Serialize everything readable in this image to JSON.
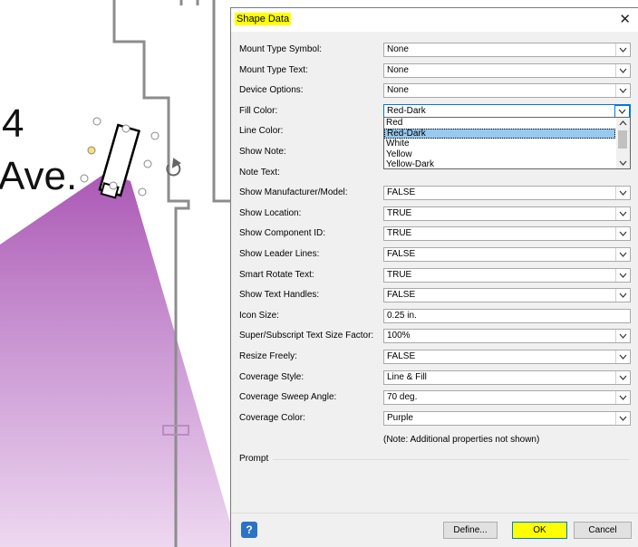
{
  "canvas": {
    "text_line1": "4",
    "text_line2": "Ave."
  },
  "dialog": {
    "title": "Shape Data",
    "close_glyph": "✕",
    "rows": [
      {
        "label": "Mount Type Symbol:",
        "value": "None",
        "kind": "dropdown"
      },
      {
        "label": "Mount Type Text:",
        "value": "None",
        "kind": "dropdown"
      },
      {
        "label": "Device Options:",
        "value": "None",
        "kind": "dropdown"
      },
      {
        "label": "Fill Color:",
        "value": "Red-Dark",
        "kind": "dropdown-open"
      },
      {
        "label": "Line Color:",
        "value": "",
        "kind": "hidden"
      },
      {
        "label": "Show Note:",
        "value": "",
        "kind": "hidden"
      },
      {
        "label": "Note Text:",
        "value": "",
        "kind": "hidden"
      },
      {
        "label": "Show Manufacturer/Model:",
        "value": "FALSE",
        "kind": "dropdown"
      },
      {
        "label": "Show Location:",
        "value": "TRUE",
        "kind": "dropdown"
      },
      {
        "label": "Show Component ID:",
        "value": "TRUE",
        "kind": "dropdown"
      },
      {
        "label": "Show Leader Lines:",
        "value": "FALSE",
        "kind": "dropdown"
      },
      {
        "label": "Smart Rotate Text:",
        "value": "TRUE",
        "kind": "dropdown"
      },
      {
        "label": "Show Text Handles:",
        "value": "FALSE",
        "kind": "dropdown"
      },
      {
        "label": "Icon Size:",
        "value": "0.25 in.",
        "kind": "text"
      },
      {
        "label": "Super/Subscript Text Size Factor:",
        "value": "100%",
        "kind": "dropdown"
      },
      {
        "label": "Resize Freely:",
        "value": "FALSE",
        "kind": "dropdown"
      },
      {
        "label": "Coverage Style:",
        "value": "Line & Fill",
        "kind": "dropdown"
      },
      {
        "label": "Coverage Sweep Angle:",
        "value": "70 deg.",
        "kind": "dropdown"
      },
      {
        "label": "Coverage Color:",
        "value": "Purple",
        "kind": "dropdown"
      }
    ],
    "fill_color_options": [
      "Red",
      "Red-Dark",
      "White",
      "Yellow",
      "Yellow-Dark"
    ],
    "fill_color_selected": "Red-Dark",
    "note": "(Note: Additional properties not shown)",
    "prompt_label": "Prompt",
    "help_glyph": "?",
    "define_label": "Define...",
    "ok_label": "OK",
    "cancel_label": "Cancel"
  },
  "colors": {
    "highlight": "#ffff00",
    "coverage": "#b36bbf",
    "accent": "#0078d7"
  }
}
